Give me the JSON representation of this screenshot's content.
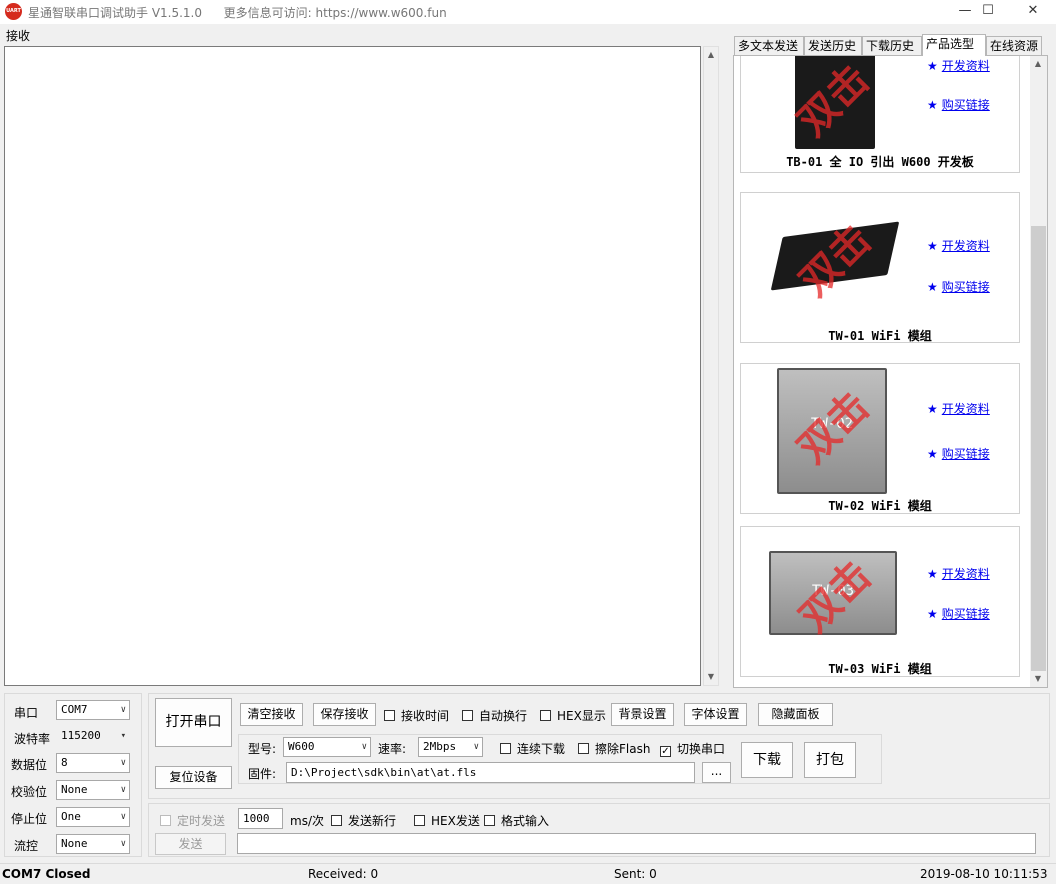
{
  "window": {
    "title": "星通智联串口调试助手 V1.5.1.0",
    "info": "更多信息可访问: https://www.w600.fun",
    "icon_text": "UART",
    "controls": [
      "—",
      "☐",
      "✕"
    ]
  },
  "receive": {
    "label": "接收"
  },
  "tabs": [
    {
      "label": "多文本发送"
    },
    {
      "label": "发送历史"
    },
    {
      "label": "下载历史"
    },
    {
      "label": "产品选型",
      "active": true
    },
    {
      "label": "在线资源"
    }
  ],
  "products": [
    {
      "name": "TB-01 全 IO 引出 W600 开发板",
      "img_mark": "",
      "link_dev": "开发资料",
      "link_buy": "购买链接",
      "watermark": "双击"
    },
    {
      "name": "TW-01 WiFi 模组",
      "img_mark": "",
      "link_dev": "开发资料",
      "link_buy": "购买链接",
      "watermark": "双击"
    },
    {
      "name": "TW-02 WiFi 模组",
      "img_mark": "TW-02",
      "link_dev": "开发资料",
      "link_buy": "购买链接",
      "watermark": "双击"
    },
    {
      "name": "TW-03 WiFi 模组",
      "img_mark": "TW-03",
      "link_dev": "开发资料",
      "link_buy": "购买链接",
      "watermark": "双击"
    }
  ],
  "serial": {
    "port": {
      "label": "串口",
      "value": "COM7"
    },
    "baud": {
      "label": "波特率",
      "value": "115200"
    },
    "data_bits": {
      "label": "数据位",
      "value": "8"
    },
    "parity": {
      "label": "校验位",
      "value": "None"
    },
    "stop_bits": {
      "label": "停止位",
      "value": "One"
    },
    "flow": {
      "label": "流控",
      "value": "None"
    }
  },
  "actions": {
    "open_port": "打开串口",
    "reset_device": "复位设备",
    "clear_recv": "清空接收",
    "save_recv": "保存接收",
    "recv_time": "接收时间",
    "auto_wrap": "自动换行",
    "hex_display": "HEX显示",
    "bg_settings": "背景设置",
    "font_settings": "字体设置",
    "hide_panel": "隐藏面板"
  },
  "download": {
    "model_label": "型号:",
    "model_value": "W600",
    "speed_label": "速率:",
    "speed_value": "2Mbps",
    "continuous": "连续下载",
    "erase_flash": "擦除Flash",
    "switch_port": "切换串口",
    "firmware_label": "固件:",
    "firmware_value": "D:\\Project\\sdk\\bin\\at\\at.fls",
    "browse": "...",
    "download_btn": "下载",
    "pack_btn": "打包"
  },
  "send": {
    "timed_send": "定时发送",
    "interval_value": "1000",
    "interval_unit": "ms/次",
    "send_newline": "发送新行",
    "hex_send": "HEX发送",
    "format_input": "格式输入",
    "send_btn": "发送",
    "input_value": ""
  },
  "status": {
    "port_state": "COM7 Closed",
    "received": "Received: 0",
    "sent": "Sent: 0",
    "datetime": "2019-08-10 10:11:53"
  }
}
